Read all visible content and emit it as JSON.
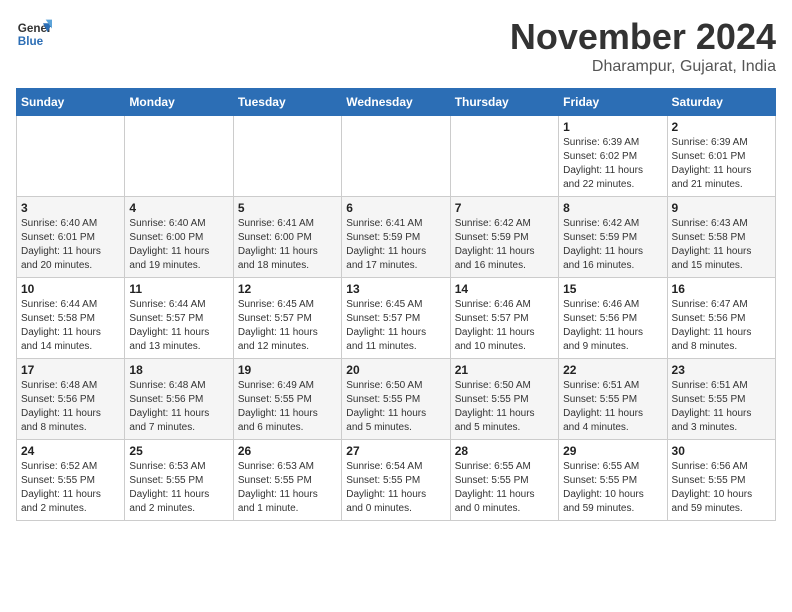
{
  "header": {
    "logo_line1": "General",
    "logo_line2": "Blue",
    "month": "November 2024",
    "location": "Dharampur, Gujarat, India"
  },
  "days_of_week": [
    "Sunday",
    "Monday",
    "Tuesday",
    "Wednesday",
    "Thursday",
    "Friday",
    "Saturday"
  ],
  "weeks": [
    [
      {
        "day": "",
        "info": ""
      },
      {
        "day": "",
        "info": ""
      },
      {
        "day": "",
        "info": ""
      },
      {
        "day": "",
        "info": ""
      },
      {
        "day": "",
        "info": ""
      },
      {
        "day": "1",
        "info": "Sunrise: 6:39 AM\nSunset: 6:02 PM\nDaylight: 11 hours\nand 22 minutes."
      },
      {
        "day": "2",
        "info": "Sunrise: 6:39 AM\nSunset: 6:01 PM\nDaylight: 11 hours\nand 21 minutes."
      }
    ],
    [
      {
        "day": "3",
        "info": "Sunrise: 6:40 AM\nSunset: 6:01 PM\nDaylight: 11 hours\nand 20 minutes."
      },
      {
        "day": "4",
        "info": "Sunrise: 6:40 AM\nSunset: 6:00 PM\nDaylight: 11 hours\nand 19 minutes."
      },
      {
        "day": "5",
        "info": "Sunrise: 6:41 AM\nSunset: 6:00 PM\nDaylight: 11 hours\nand 18 minutes."
      },
      {
        "day": "6",
        "info": "Sunrise: 6:41 AM\nSunset: 5:59 PM\nDaylight: 11 hours\nand 17 minutes."
      },
      {
        "day": "7",
        "info": "Sunrise: 6:42 AM\nSunset: 5:59 PM\nDaylight: 11 hours\nand 16 minutes."
      },
      {
        "day": "8",
        "info": "Sunrise: 6:42 AM\nSunset: 5:59 PM\nDaylight: 11 hours\nand 16 minutes."
      },
      {
        "day": "9",
        "info": "Sunrise: 6:43 AM\nSunset: 5:58 PM\nDaylight: 11 hours\nand 15 minutes."
      }
    ],
    [
      {
        "day": "10",
        "info": "Sunrise: 6:44 AM\nSunset: 5:58 PM\nDaylight: 11 hours\nand 14 minutes."
      },
      {
        "day": "11",
        "info": "Sunrise: 6:44 AM\nSunset: 5:57 PM\nDaylight: 11 hours\nand 13 minutes."
      },
      {
        "day": "12",
        "info": "Sunrise: 6:45 AM\nSunset: 5:57 PM\nDaylight: 11 hours\nand 12 minutes."
      },
      {
        "day": "13",
        "info": "Sunrise: 6:45 AM\nSunset: 5:57 PM\nDaylight: 11 hours\nand 11 minutes."
      },
      {
        "day": "14",
        "info": "Sunrise: 6:46 AM\nSunset: 5:57 PM\nDaylight: 11 hours\nand 10 minutes."
      },
      {
        "day": "15",
        "info": "Sunrise: 6:46 AM\nSunset: 5:56 PM\nDaylight: 11 hours\nand 9 minutes."
      },
      {
        "day": "16",
        "info": "Sunrise: 6:47 AM\nSunset: 5:56 PM\nDaylight: 11 hours\nand 8 minutes."
      }
    ],
    [
      {
        "day": "17",
        "info": "Sunrise: 6:48 AM\nSunset: 5:56 PM\nDaylight: 11 hours\nand 8 minutes."
      },
      {
        "day": "18",
        "info": "Sunrise: 6:48 AM\nSunset: 5:56 PM\nDaylight: 11 hours\nand 7 minutes."
      },
      {
        "day": "19",
        "info": "Sunrise: 6:49 AM\nSunset: 5:55 PM\nDaylight: 11 hours\nand 6 minutes."
      },
      {
        "day": "20",
        "info": "Sunrise: 6:50 AM\nSunset: 5:55 PM\nDaylight: 11 hours\nand 5 minutes."
      },
      {
        "day": "21",
        "info": "Sunrise: 6:50 AM\nSunset: 5:55 PM\nDaylight: 11 hours\nand 5 minutes."
      },
      {
        "day": "22",
        "info": "Sunrise: 6:51 AM\nSunset: 5:55 PM\nDaylight: 11 hours\nand 4 minutes."
      },
      {
        "day": "23",
        "info": "Sunrise: 6:51 AM\nSunset: 5:55 PM\nDaylight: 11 hours\nand 3 minutes."
      }
    ],
    [
      {
        "day": "24",
        "info": "Sunrise: 6:52 AM\nSunset: 5:55 PM\nDaylight: 11 hours\nand 2 minutes."
      },
      {
        "day": "25",
        "info": "Sunrise: 6:53 AM\nSunset: 5:55 PM\nDaylight: 11 hours\nand 2 minutes."
      },
      {
        "day": "26",
        "info": "Sunrise: 6:53 AM\nSunset: 5:55 PM\nDaylight: 11 hours\nand 1 minute."
      },
      {
        "day": "27",
        "info": "Sunrise: 6:54 AM\nSunset: 5:55 PM\nDaylight: 11 hours\nand 0 minutes."
      },
      {
        "day": "28",
        "info": "Sunrise: 6:55 AM\nSunset: 5:55 PM\nDaylight: 11 hours\nand 0 minutes."
      },
      {
        "day": "29",
        "info": "Sunrise: 6:55 AM\nSunset: 5:55 PM\nDaylight: 10 hours\nand 59 minutes."
      },
      {
        "day": "30",
        "info": "Sunrise: 6:56 AM\nSunset: 5:55 PM\nDaylight: 10 hours\nand 59 minutes."
      }
    ]
  ]
}
